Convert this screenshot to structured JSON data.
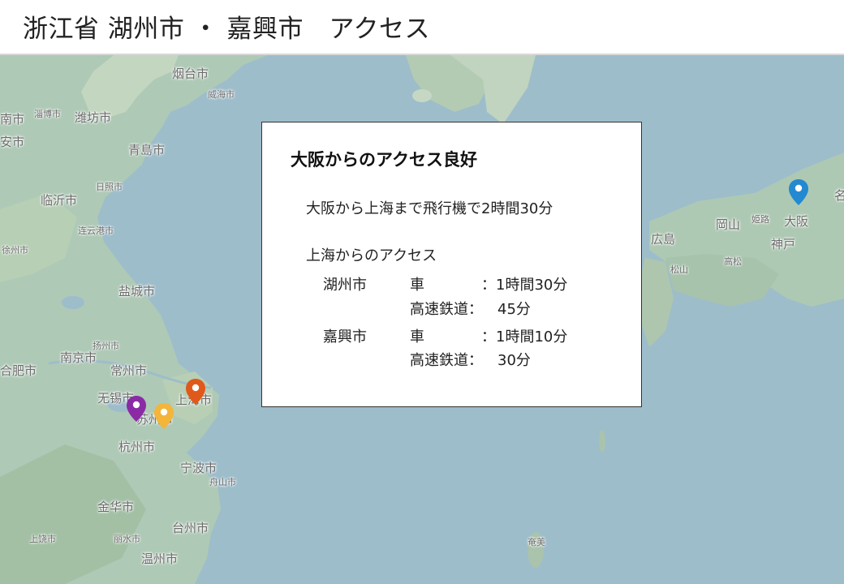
{
  "header": {
    "title": "浙江省 湖州市 ・ 嘉興市　アクセス"
  },
  "map": {
    "labels": [
      {
        "name": "yantai",
        "text": "烟台市",
        "size": "",
        "pos": "a"
      },
      {
        "name": "weihai",
        "text": "威海市",
        "size": "sm",
        "pos": "b"
      },
      {
        "name": "nan",
        "text": "南市",
        "size": "",
        "pos": "c"
      },
      {
        "name": "zibo",
        "text": "淄博市",
        "size": "sm",
        "pos": "d"
      },
      {
        "name": "weifang",
        "text": "潍坊市",
        "size": "",
        "pos": "e"
      },
      {
        "name": "an",
        "text": "安市",
        "size": "",
        "pos": "f"
      },
      {
        "name": "qingdao",
        "text": "青島市",
        "size": "",
        "pos": "g"
      },
      {
        "name": "rizhao",
        "text": "日照市",
        "size": "sm",
        "pos": "h"
      },
      {
        "name": "linyi",
        "text": "临沂市",
        "size": "",
        "pos": "i"
      },
      {
        "name": "lianyungang",
        "text": "连云港市",
        "size": "sm",
        "pos": "j"
      },
      {
        "name": "xuzhou",
        "text": "徐州市",
        "size": "sm",
        "pos": "k"
      },
      {
        "name": "yancheng",
        "text": "盐城市",
        "size": "",
        "pos": "l"
      },
      {
        "name": "yangzhou",
        "text": "扬州市",
        "size": "sm",
        "pos": "m"
      },
      {
        "name": "nanjing",
        "text": "南京市",
        "size": "",
        "pos": "n"
      },
      {
        "name": "hefei",
        "text": "合肥市",
        "size": "",
        "pos": "o"
      },
      {
        "name": "changzhou",
        "text": "常州市",
        "size": "",
        "pos": "p"
      },
      {
        "name": "wuxi",
        "text": "无锡市",
        "size": "",
        "pos": "q"
      },
      {
        "name": "suzhou",
        "text": "苏州市",
        "size": "",
        "pos": "r"
      },
      {
        "name": "shanghai",
        "text": "上海市",
        "size": "",
        "pos": "s"
      },
      {
        "name": "hangzhou",
        "text": "杭州市",
        "size": "",
        "pos": "t"
      },
      {
        "name": "ningbo",
        "text": "宁波市",
        "size": "",
        "pos": "u"
      },
      {
        "name": "zhoushan",
        "text": "舟山市",
        "size": "sm",
        "pos": "v"
      },
      {
        "name": "jinhua",
        "text": "金华市",
        "size": "",
        "pos": "w"
      },
      {
        "name": "taizhou",
        "text": "台州市",
        "size": "",
        "pos": "x"
      },
      {
        "name": "lishui",
        "text": "丽水市",
        "size": "sm",
        "pos": "y"
      },
      {
        "name": "shangrao",
        "text": "上饶市",
        "size": "sm",
        "pos": "z"
      },
      {
        "name": "wenzhou",
        "text": "温州市",
        "size": "",
        "pos": "aa"
      },
      {
        "name": "amami",
        "text": "奄美",
        "size": "sm",
        "pos": "ab"
      },
      {
        "name": "hiroshima",
        "text": "広島",
        "size": "",
        "pos": "ac"
      },
      {
        "name": "okayama",
        "text": "岡山",
        "size": "",
        "pos": "ad"
      },
      {
        "name": "himeji",
        "text": "姫路",
        "size": "sm",
        "pos": "ae"
      },
      {
        "name": "osaka",
        "text": "大阪",
        "size": "",
        "pos": "af"
      },
      {
        "name": "kobe",
        "text": "神戸",
        "size": "",
        "pos": "ag"
      },
      {
        "name": "takamatsu",
        "text": "高松",
        "size": "sm",
        "pos": "ah"
      },
      {
        "name": "matsuyama",
        "text": "松山",
        "size": "sm",
        "pos": "ai"
      },
      {
        "name": "na",
        "text": "名",
        "size": "",
        "pos": "aj"
      }
    ],
    "pins": [
      {
        "name": "osaka-pin",
        "color": "#2389d0"
      },
      {
        "name": "shanghai-pin",
        "color": "#e0591b"
      },
      {
        "name": "huzhou-pin",
        "color": "#8b2aa5"
      },
      {
        "name": "jiaxing-pin",
        "color": "#f3b53a"
      }
    ]
  },
  "info": {
    "heading": "大阪からのアクセス良好",
    "flight": "大阪から上海まで飛行機で2時間30分",
    "from_shanghai": "上海からのアクセス",
    "routes": [
      {
        "city": "湖州市",
        "car_label": "車",
        "car_time": "：1時間30分",
        "rail_label": "高速鉄道：",
        "rail_time": "45分"
      },
      {
        "city": "嘉興市",
        "car_label": "車",
        "car_time": "：1時間10分",
        "rail_label": "高速鉄道：",
        "rail_time": "30分"
      }
    ]
  }
}
